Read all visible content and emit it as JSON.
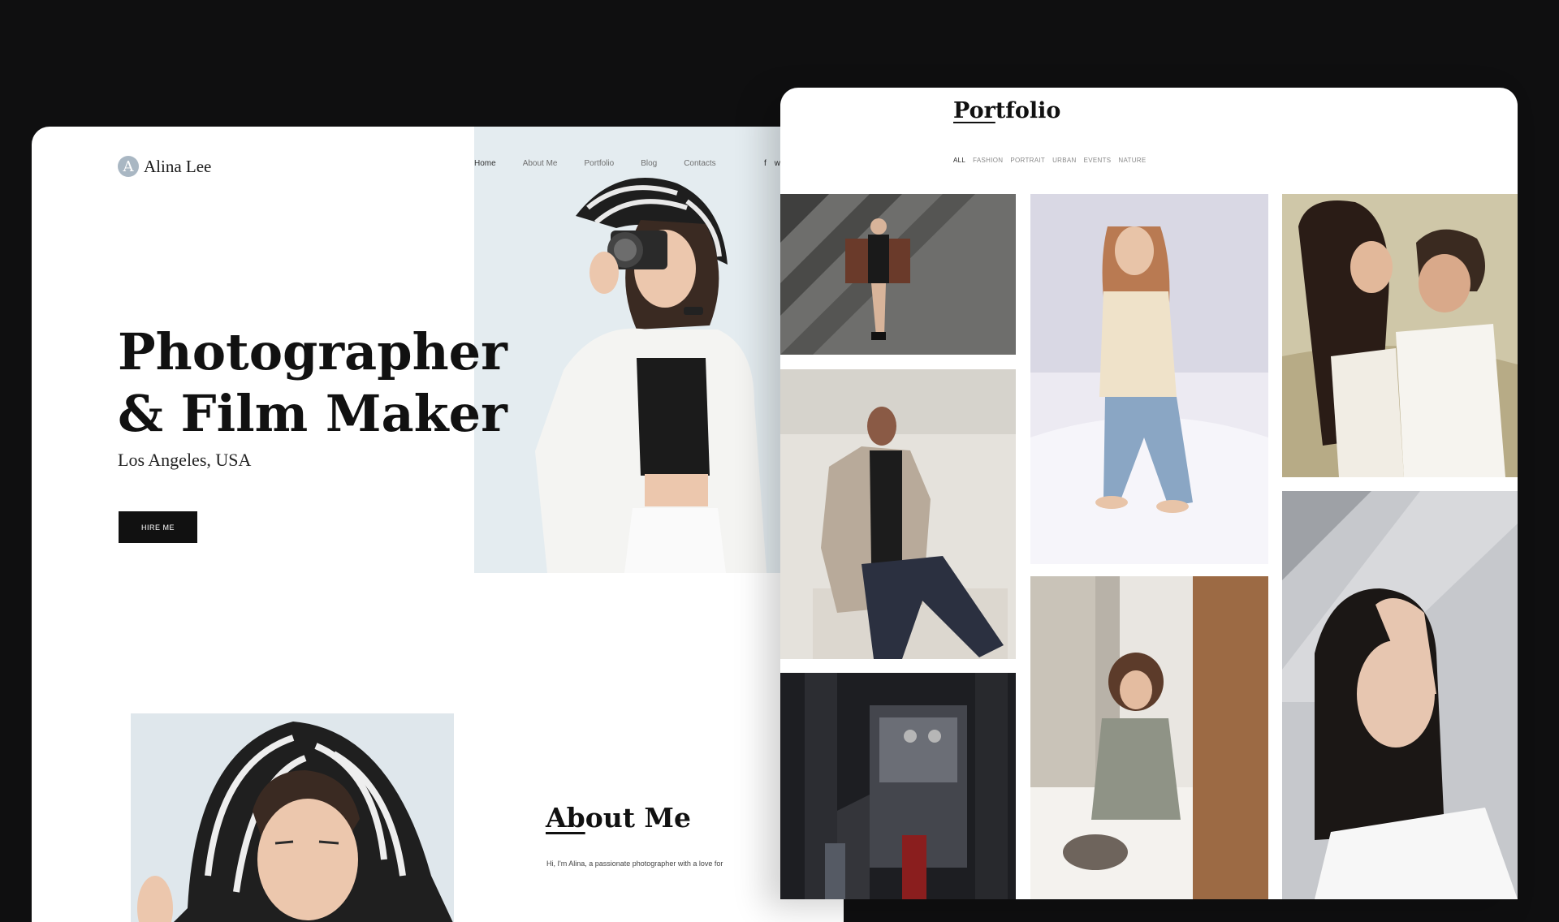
{
  "home": {
    "brand": {
      "mark": "A",
      "name": "Alina Lee"
    },
    "nav": [
      "Home",
      "About Me",
      "Portfolio",
      "Blog",
      "Contacts"
    ],
    "social": [
      "f",
      "w"
    ],
    "hero": {
      "title_line1": "Photographer",
      "title_line2": "& Film Maker",
      "location": "Los Angeles, USA",
      "cta": "HIRE ME"
    },
    "about": {
      "title_underlined": "Ab",
      "title_rest": "out Me",
      "text": "Hi, I'm Alina, a passionate photographer with a love for"
    }
  },
  "portfolio": {
    "title_underlined": "Por",
    "title_rest": "tfolio",
    "filters": [
      "ALL",
      "FASHION",
      "PORTRAIT",
      "URBAN",
      "EVENTS",
      "NATURE"
    ],
    "active_filter": "ALL"
  },
  "colors": {
    "page_background": "#0f0f10",
    "card_background": "#ffffff",
    "text_dark": "#111111",
    "button_background": "#111111",
    "brand_mark": "#a9b7c3"
  }
}
